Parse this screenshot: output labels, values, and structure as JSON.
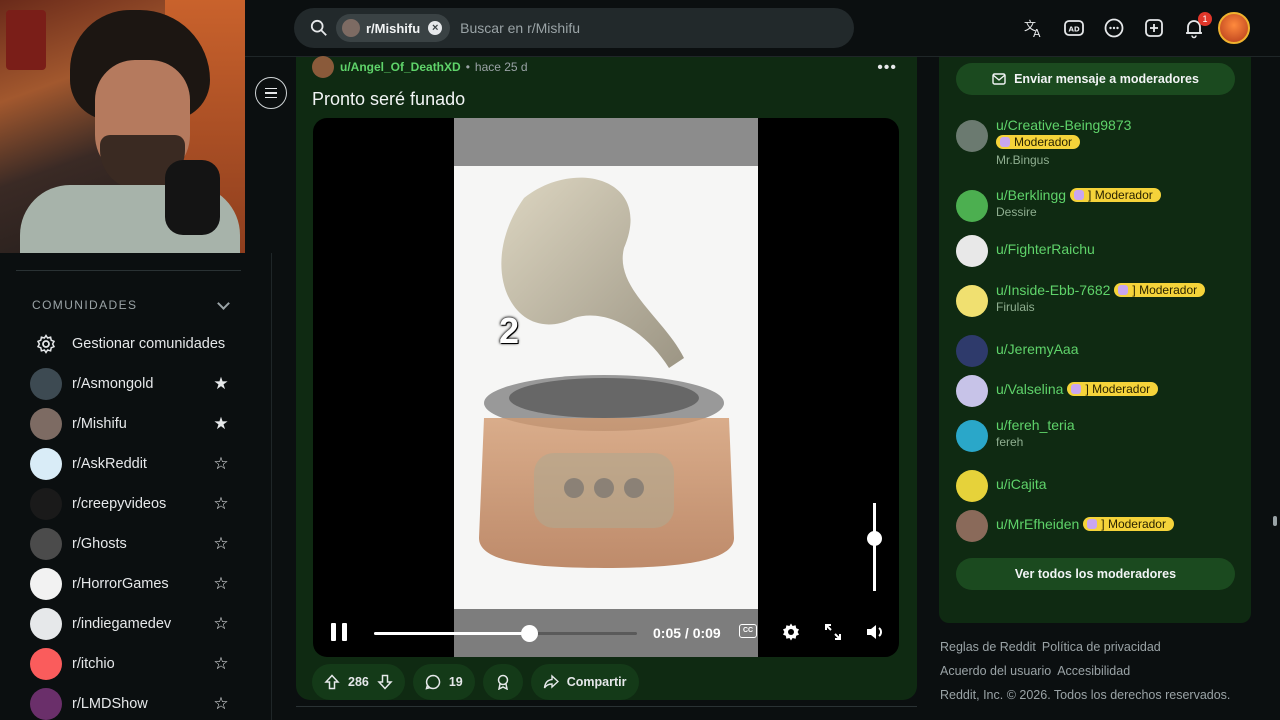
{
  "topbar": {
    "subreddit_chip": "r/Mishifu",
    "search_placeholder": "Buscar en r/Mishifu",
    "notifications_count": "1"
  },
  "sidebar": {
    "section_title": "COMUNIDADES",
    "manage_label": "Gestionar comunidades",
    "communities": [
      {
        "label": "r/Asmongold",
        "favorite": true,
        "color": "#3d4a52"
      },
      {
        "label": "r/Mishifu",
        "favorite": true,
        "color": "#7d6b63"
      },
      {
        "label": "r/AskReddit",
        "favorite": false,
        "color": "#d9ecf7"
      },
      {
        "label": "r/creepyvideos",
        "favorite": false,
        "color": "#1a1a1a"
      },
      {
        "label": "r/Ghosts",
        "favorite": false,
        "color": "#4b4b4b"
      },
      {
        "label": "r/HorrorGames",
        "favorite": false,
        "color": "#f2f2f2"
      },
      {
        "label": "r/indiegamedev",
        "favorite": false,
        "color": "#e6e8ea"
      },
      {
        "label": "r/itchio",
        "favorite": false,
        "color": "#fa5c5c"
      },
      {
        "label": "r/LMDShow",
        "favorite": false,
        "color": "#6a2f6a"
      }
    ]
  },
  "post": {
    "author": "u/Angel_Of_DeathXD",
    "separator": "•",
    "time": "hace 25 d",
    "title": "Pronto seré funado",
    "video": {
      "overlay_number": "2",
      "current_time": "0:05 / 0:09",
      "progress": 0.59,
      "volume": 0.6
    },
    "votes": "286",
    "comments": "19",
    "share_label": "Compartir"
  },
  "right_panel": {
    "message_button": "Enviar mensaje a moderadores",
    "moderators": [
      {
        "name": "u/Creative-Being9873",
        "flair": "Moderador",
        "sub": "Mr.Bingus",
        "flair_inline": false,
        "color": "#6b7a70"
      },
      {
        "name": "u/Berklingg",
        "flair": "] Moderador",
        "sub": "Dessire",
        "flair_inline": true,
        "color": "#4caf50"
      },
      {
        "name": "u/FighterRaichu",
        "flair": "",
        "sub": "",
        "flair_inline": true,
        "color": "#e8e8e8"
      },
      {
        "name": "u/Inside-Ebb-7682",
        "flair": "] Moderador",
        "sub": "Firulais",
        "flair_inline": true,
        "color": "#f0e070"
      },
      {
        "name": "u/JeremyAaa",
        "flair": "",
        "sub": "",
        "flair_inline": true,
        "color": "#2e3a6b"
      },
      {
        "name": "u/Valselina",
        "flair": "] Moderador",
        "sub": "",
        "flair_inline": true,
        "color": "#c7c3e8"
      },
      {
        "name": "u/fereh_teria",
        "flair": "",
        "sub": "fereh",
        "flair_inline": true,
        "color": "#2aa7c9"
      },
      {
        "name": "u/iCajita",
        "flair": "",
        "sub": "",
        "flair_inline": true,
        "color": "#e6d23a"
      },
      {
        "name": "u/MrEfheiden",
        "flair": "] Moderador",
        "sub": "",
        "flair_inline": true,
        "color": "#8a6a5a"
      }
    ],
    "all_mods_button": "Ver todos los moderadores"
  },
  "footer": {
    "rules": "Reglas de Reddit",
    "privacy": "Política de privacidad",
    "agreement": "Acuerdo del usuario",
    "accessibility": "Accesibilidad",
    "copyright": "Reddit, Inc. © 2026. Todos los derechos reservados."
  },
  "colors": {
    "accent_green": "#5fd36a",
    "panel_green": "#0f2a12",
    "flair_yellow": "#f5d33a"
  }
}
